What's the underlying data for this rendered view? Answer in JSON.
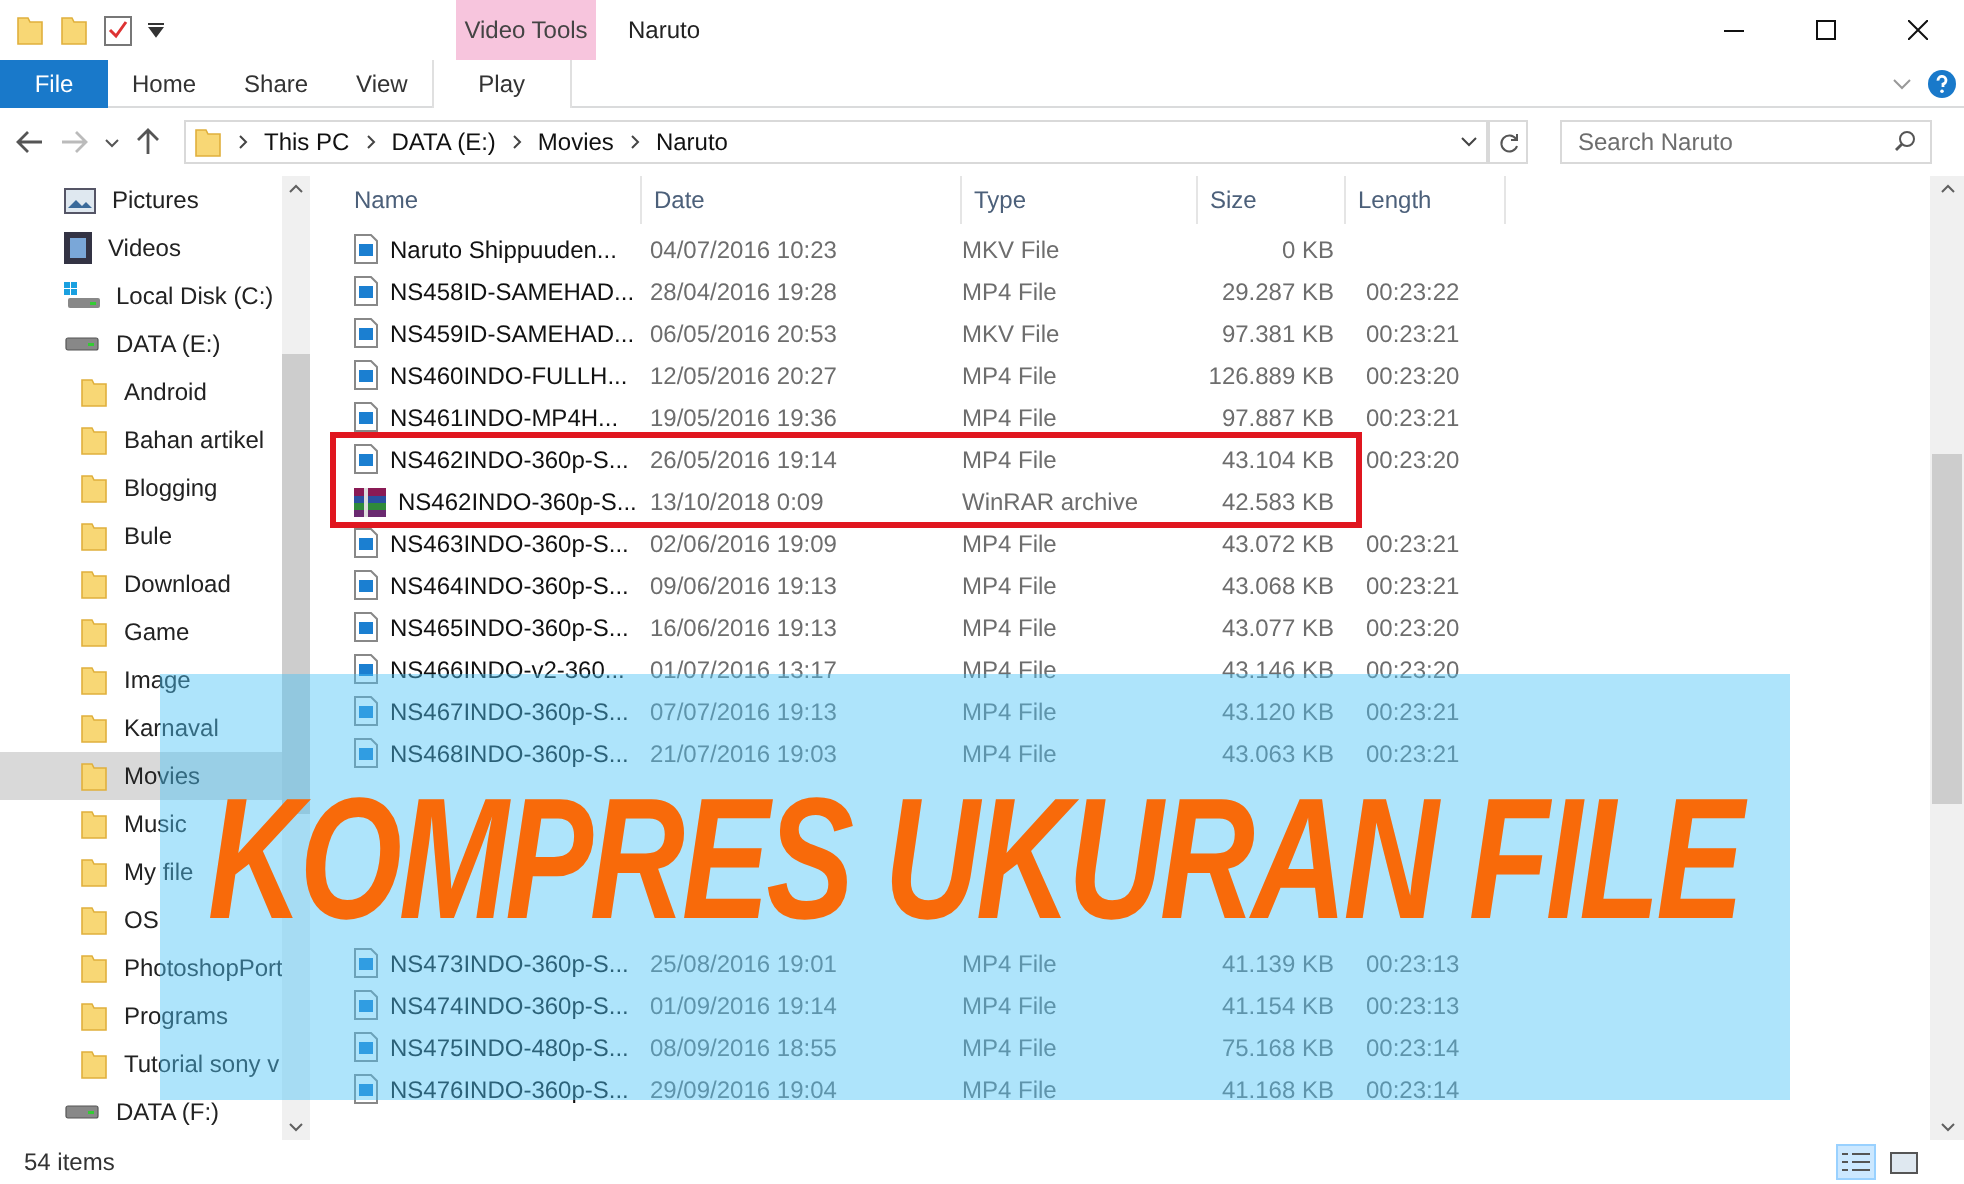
{
  "window": {
    "title": "Naruto",
    "context_tab": "Video Tools"
  },
  "ribbon_tabs": [
    {
      "label": "File",
      "selected": false,
      "kind": "file"
    },
    {
      "label": "Home",
      "selected": false,
      "kind": "tab"
    },
    {
      "label": "Share",
      "selected": false,
      "kind": "tab"
    },
    {
      "label": "View",
      "selected": false,
      "kind": "tab"
    },
    {
      "label": "Play",
      "selected": false,
      "kind": "context"
    }
  ],
  "address": {
    "crumbs": [
      "This PC",
      "DATA (E:)",
      "Movies",
      "Naruto"
    ],
    "search_placeholder": "Search Naruto"
  },
  "sidebar": {
    "items": [
      {
        "label": "Pictures",
        "kind": "pictures",
        "selected": false
      },
      {
        "label": "Videos",
        "kind": "videos",
        "selected": false
      },
      {
        "label": "Local Disk (C:)",
        "kind": "system-disk",
        "selected": false
      },
      {
        "label": "DATA (E:)",
        "kind": "drive",
        "selected": false,
        "children": [
          {
            "label": "Android",
            "kind": "folder",
            "selected": false
          },
          {
            "label": "Bahan artikel",
            "kind": "folder",
            "selected": false
          },
          {
            "label": "Blogging",
            "kind": "folder",
            "selected": false
          },
          {
            "label": "Bule",
            "kind": "folder",
            "selected": false
          },
          {
            "label": "Download",
            "kind": "folder",
            "selected": false
          },
          {
            "label": "Game",
            "kind": "folder",
            "selected": false
          },
          {
            "label": "Image",
            "kind": "folder",
            "selected": false
          },
          {
            "label": "Karnaval",
            "kind": "folder",
            "selected": false
          },
          {
            "label": "Movies",
            "kind": "folder",
            "selected": true
          },
          {
            "label": "Music",
            "kind": "folder",
            "selected": false
          },
          {
            "label": "My file",
            "kind": "folder",
            "selected": false
          },
          {
            "label": "OS",
            "kind": "folder",
            "selected": false
          },
          {
            "label": "PhotoshopPort",
            "kind": "folder",
            "selected": false
          },
          {
            "label": "Programs",
            "kind": "folder",
            "selected": false
          },
          {
            "label": "Tutorial sony v",
            "kind": "folder",
            "selected": false
          }
        ]
      },
      {
        "label": "DATA (F:)",
        "kind": "drive",
        "selected": false
      }
    ]
  },
  "table": {
    "columns": [
      "Name",
      "Date",
      "Type",
      "Size",
      "Length"
    ],
    "rows": [
      {
        "kind": "video",
        "name": "Naruto Shippuuden...",
        "date": "04/07/2016 10:23",
        "type": "MKV File",
        "size": "0 KB"
      },
      {
        "kind": "video",
        "name": "NS458ID-SAMEHAD...",
        "date": "28/04/2016 19:28",
        "type": "MP4 File",
        "size": "29.287 KB",
        "length": "00:23:22"
      },
      {
        "kind": "video",
        "name": "NS459ID-SAMEHAD...",
        "date": "06/05/2016 20:53",
        "type": "MKV File",
        "size": "97.381 KB",
        "length": "00:23:21"
      },
      {
        "kind": "video",
        "name": "NS460INDO-FULLH...",
        "date": "12/05/2016 20:27",
        "type": "MP4 File",
        "size": "126.889 KB",
        "length": "00:23:20"
      },
      {
        "kind": "video",
        "name": "NS461INDO-MP4H...",
        "date": "19/05/2016 19:36",
        "type": "MP4 File",
        "size": "97.887 KB",
        "length": "00:23:21"
      },
      {
        "kind": "video",
        "highlighted": true,
        "name": "NS462INDO-360p-S...",
        "date": "26/05/2016 19:14",
        "type": "MP4 File",
        "size": "43.104 KB",
        "length": "00:23:20"
      },
      {
        "kind": "archive",
        "highlighted": true,
        "name": "NS462INDO-360p-S...",
        "date": "13/10/2018 0:09",
        "type": "WinRAR archive",
        "size": "42.583 KB"
      },
      {
        "kind": "video",
        "name": "NS463INDO-360p-S...",
        "date": "02/06/2016 19:09",
        "type": "MP4 File",
        "size": "43.072 KB",
        "length": "00:23:21"
      },
      {
        "kind": "video",
        "name": "NS464INDO-360p-S...",
        "date": "09/06/2016 19:13",
        "type": "MP4 File",
        "size": "43.068 KB",
        "length": "00:23:21"
      },
      {
        "kind": "video",
        "name": "NS465INDO-360p-S...",
        "date": "16/06/2016 19:13",
        "type": "MP4 File",
        "size": "43.077 KB",
        "length": "00:23:20"
      },
      {
        "kind": "video",
        "name": "NS466INDO-v2-360...",
        "date": "01/07/2016 13:17",
        "type": "MP4 File",
        "size": "43.146 KB",
        "length": "00:23:20"
      },
      {
        "kind": "video",
        "name": "NS467INDO-360p-S...",
        "date": "07/07/2016 19:13",
        "type": "MP4 File",
        "size": "43.120 KB",
        "length": "00:23:21"
      },
      {
        "kind": "video",
        "name": "NS468INDO-360p-S...",
        "date": "21/07/2016 19:03",
        "type": "MP4 File",
        "size": "43.063 KB",
        "length": "00:23:21"
      },
      {
        "kind": "covered"
      },
      {
        "kind": "covered"
      },
      {
        "kind": "covered"
      },
      {
        "kind": "covered"
      },
      {
        "kind": "video",
        "name": "NS473INDO-360p-S...",
        "date": "25/08/2016 19:01",
        "type": "MP4 File",
        "size": "41.139 KB",
        "length": "00:23:13"
      },
      {
        "kind": "video",
        "name": "NS474INDO-360p-S...",
        "date": "01/09/2016 19:14",
        "type": "MP4 File",
        "size": "41.154 KB",
        "length": "00:23:13"
      },
      {
        "kind": "video",
        "name": "NS475INDO-480p-S...",
        "date": "08/09/2016 18:55",
        "type": "MP4 File",
        "size": "75.168 KB",
        "length": "00:23:14"
      },
      {
        "kind": "video",
        "name": "NS476INDO-360p-S...",
        "date": "29/09/2016 19:04",
        "type": "MP4 File",
        "size": "41.168 KB",
        "length": "00:23:14"
      }
    ]
  },
  "banner": {
    "text": "KOMPRES UKURAN FILE"
  },
  "status_bar": {
    "count": "54 items"
  }
}
